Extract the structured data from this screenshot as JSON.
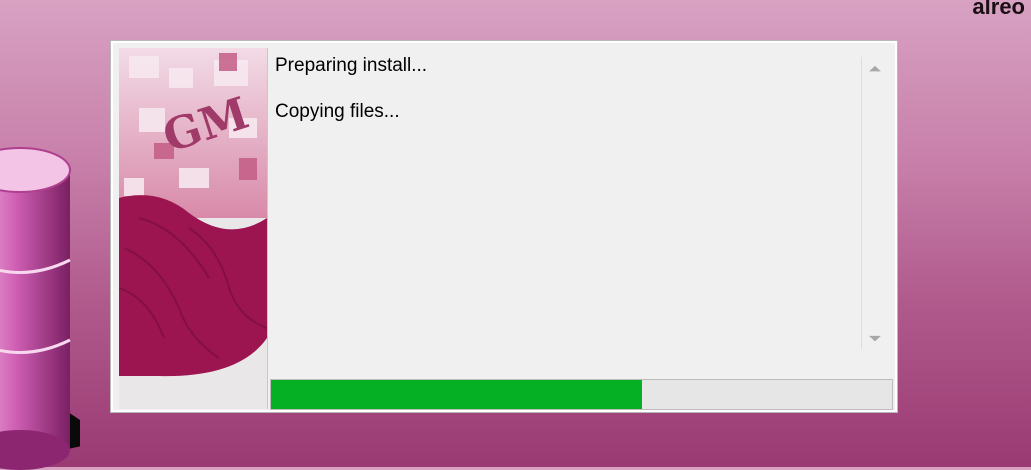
{
  "corner_text": "alreo",
  "installer": {
    "log": [
      "Preparing install...",
      "Copying files..."
    ],
    "progress_fraction": 0.597
  },
  "icons": {
    "scroll_up": "▲",
    "scroll_down": "▼",
    "side_art": "installer-banner-image",
    "background_db": "database-cylinder-icon"
  },
  "colors": {
    "progress_fill": "#06b025",
    "banner_magenta": "#9c1450"
  }
}
